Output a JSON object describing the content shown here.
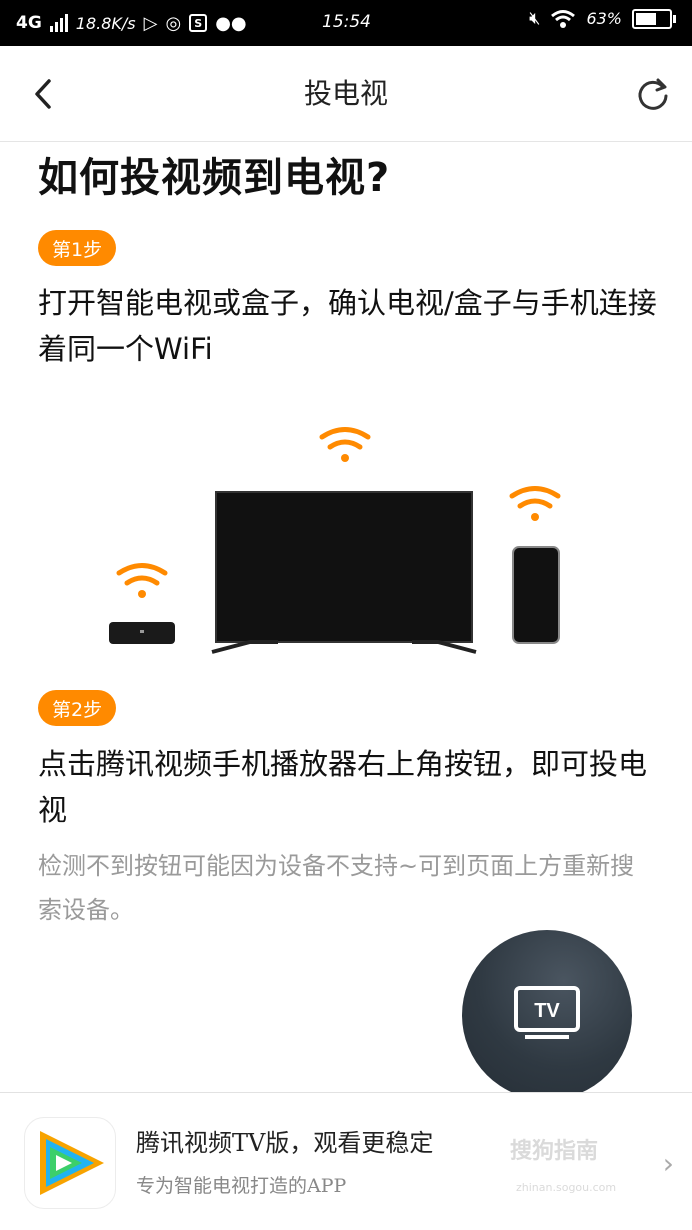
{
  "status_bar": {
    "network": "4G",
    "speed": "18.8K/s",
    "time": "15:54",
    "battery": "63%",
    "battery_level": 0.63
  },
  "header": {
    "title": "投电视"
  },
  "main": {
    "heading": "如何投视频到电视?",
    "step1": {
      "badge": "第1步",
      "text": "打开智能电视或盒子，确认电视/盒子与手机连接着同一个WiFi"
    },
    "step2": {
      "badge": "第2步",
      "text": "点击腾讯视频手机播放器右上角按钮，即可投电视",
      "hint": "检测不到按钮可能因为设备不支持~可到页面上方重新搜索设备。"
    }
  },
  "floating_button": {
    "label": "TV"
  },
  "bottom_bar": {
    "title": "腾讯视频TV版，观看更稳定",
    "subtitle": "专为智能电视打造的APP",
    "arrow": "›",
    "watermark": "搜狗指南",
    "watermark_sub": "zhinan.sogou.com"
  },
  "colors": {
    "accent": "#ff8a00",
    "text": "#111111",
    "hint": "#9a9a9a"
  }
}
